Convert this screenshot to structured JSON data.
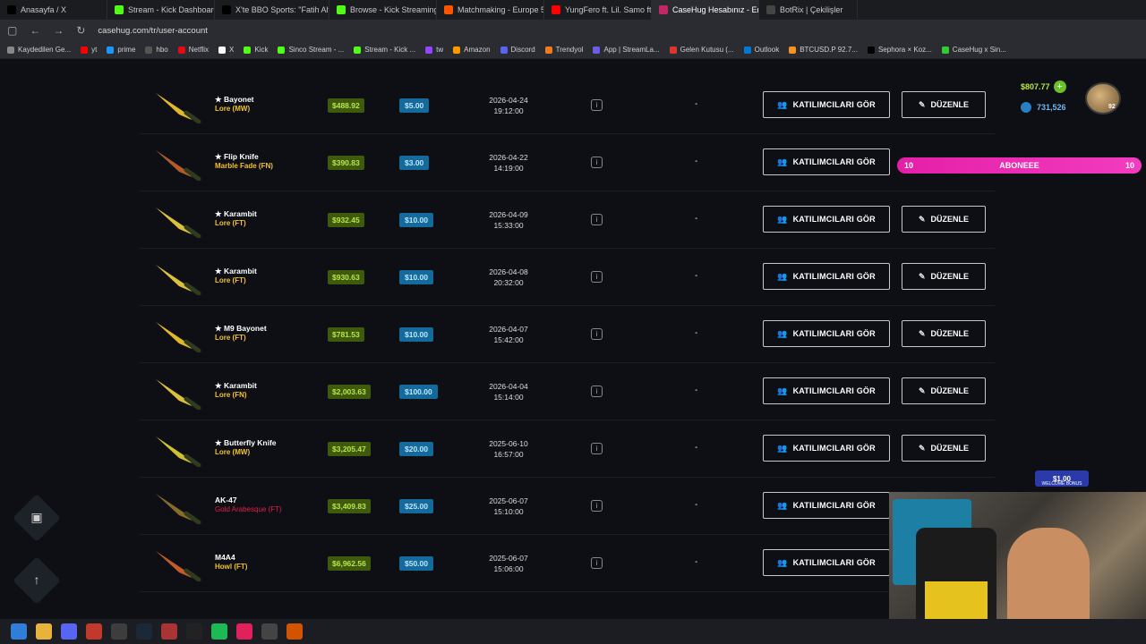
{
  "browser": {
    "tabs": [
      {
        "label": "Anasayfa / X",
        "color": "#000000"
      },
      {
        "label": "Stream - Kick Dashboard",
        "color": "#53fc18"
      },
      {
        "label": "X'te BBO Sports: \"Fatih Alt...",
        "color": "#000000"
      },
      {
        "label": "Browse - Kick Streaming",
        "color": "#53fc18"
      },
      {
        "label": "Matchmaking - Europe 5v5",
        "color": "#ff5500"
      },
      {
        "label": "YungFero ft. Lil. Samo ft. A...",
        "color": "#ff0000"
      },
      {
        "label": "CaseHug Hesabınız - Envan...",
        "color": "#c22766"
      },
      {
        "label": "BotRix | Çekilişler",
        "color": "#444444"
      }
    ],
    "url": "casehug.com/tr/user-account",
    "bookmarks": [
      "Kaydedilen Ge...",
      "yt",
      "prime",
      "hbo",
      "Netflix",
      "X",
      "Kick",
      "Sinco Stream - ...",
      "Stream - Kick ...",
      "tw",
      "Amazon",
      "Discord",
      "Trendyol",
      "App | StreamLa...",
      "Gelen Kutusu (...",
      "Outlook",
      "BTCUSD.P 92.7...",
      "Sephora × Koz...",
      "CaseHug x Sin..."
    ]
  },
  "rows": [
    {
      "name": "★ Bayonet",
      "skin": "Lore (MW)",
      "price": "$488.92",
      "entry": "$5.00",
      "date": "2026-04-24",
      "time": "19:12:00",
      "winner": "-",
      "participants_label": "KATILIMCILARI GÖR",
      "edit_label": "DÜZENLE",
      "skin_color": "gold"
    },
    {
      "name": "★ Flip Knife",
      "skin": "Marble Fade (FN)",
      "price": "$390.83",
      "entry": "$3.00",
      "date": "2026-04-22",
      "time": "14:19:00",
      "winner": "-",
      "participants_label": "KATILIMCILARI GÖR",
      "edit_label": "",
      "skin_color": "gold"
    },
    {
      "name": "★ Karambit",
      "skin": "Lore (FT)",
      "price": "$932.45",
      "entry": "$10.00",
      "date": "2026-04-09",
      "time": "15:33:00",
      "winner": "-",
      "participants_label": "KATILIMCILARI GÖR",
      "edit_label": "DÜZENLE",
      "skin_color": "gold"
    },
    {
      "name": "★ Karambit",
      "skin": "Lore (FT)",
      "price": "$930.63",
      "entry": "$10.00",
      "date": "2026-04-08",
      "time": "20:32:00",
      "winner": "-",
      "participants_label": "KATILIMCILARI GÖR",
      "edit_label": "DÜZENLE",
      "skin_color": "gold"
    },
    {
      "name": "★ M9 Bayonet",
      "skin": "Lore (FT)",
      "price": "$781.53",
      "entry": "$10.00",
      "date": "2026-04-07",
      "time": "15:42:00",
      "winner": "-",
      "participants_label": "KATILIMCILARI GÖR",
      "edit_label": "DÜZENLE",
      "skin_color": "gold"
    },
    {
      "name": "★ Karambit",
      "skin": "Lore (FN)",
      "price": "$2,003.63",
      "entry": "$100.00",
      "date": "2026-04-04",
      "time": "15:14:00",
      "winner": "-",
      "participants_label": "KATILIMCILARI GÖR",
      "edit_label": "DÜZENLE",
      "skin_color": "gold"
    },
    {
      "name": "★ Butterfly Knife",
      "skin": "Lore (MW)",
      "price": "$3,205.47",
      "entry": "$20.00",
      "date": "2025-06-10",
      "time": "16:57:00",
      "winner": "-",
      "participants_label": "KATILIMCILARI GÖR",
      "edit_label": "DÜZENLE",
      "skin_color": "gold"
    },
    {
      "name": "AK-47",
      "skin": "Gold Arabesque (FT)",
      "price": "$3,409.83",
      "entry": "$25.00",
      "date": "2025-06-07",
      "time": "15:10:00",
      "winner": "-",
      "participants_label": "KATILIMCILARI GÖR",
      "edit_label": "",
      "skin_color": "red"
    },
    {
      "name": "M4A4",
      "skin": "Howl (FT)",
      "price": "$6,962.56",
      "entry": "$50.00",
      "date": "2025-06-07",
      "time": "15:06:00",
      "winner": "-",
      "participants_label": "KATILIMCILARI GÖR",
      "edit_label": "",
      "skin_color": "gold"
    }
  ],
  "user": {
    "balance": "$807.77",
    "coins": "731,526",
    "level": "92"
  },
  "subscribe_bar": {
    "left": "10",
    "label": "ABONEEE",
    "right": "10"
  },
  "bonus": {
    "amount": "$1.00",
    "text": "WELCOME BONUS"
  },
  "colors": {
    "price_bg": "#3e5a0e",
    "entry_bg": "#156a9c",
    "skin_gold": "#f2c230",
    "skin_red": "#e0214a",
    "subscribe": "#e51ea8"
  }
}
